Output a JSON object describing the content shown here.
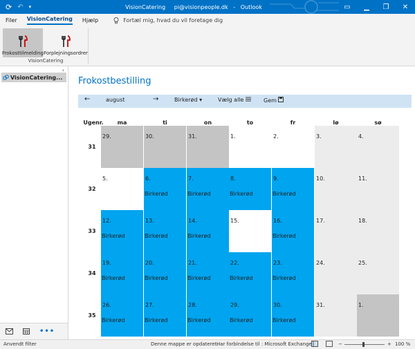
{
  "titlebar": {
    "app_name": "VisionCatering",
    "account": "pi@visionpeople.dk",
    "separator": "-",
    "product": "Outlook",
    "sync_icon": "refresh-icon",
    "undo_icon": "undo-icon",
    "controls": [
      "▭",
      "▁",
      "❐",
      "✕"
    ]
  },
  "menu": {
    "items": [
      "Filer",
      "VisionCatering",
      "Hjælp"
    ],
    "active": "VisionCatering",
    "tell_me": "Fortæl mig, hvad du vil foretage dig"
  },
  "ribbon": {
    "buttons": [
      {
        "label": "Frokosttilmelding",
        "icon": "cutlery-icon",
        "selected": true
      },
      {
        "label": "Forplejningsordrer",
        "icon": "cutlery-icon",
        "selected": false
      }
    ],
    "group_label": "VisionCatering"
  },
  "leftnav": {
    "collapse": "‹",
    "folder": "VisionCatering...",
    "folder_icon": "link-icon",
    "bottom_icons": [
      "mail-icon",
      "calendar-icon",
      "more-icon"
    ],
    "more_label": "•••"
  },
  "main": {
    "title": "Frokostbestilling",
    "toolbar": {
      "prev": "←",
      "month": "august",
      "next": "→",
      "location": "Birkerød",
      "dropdown": "▾",
      "select_all": "Vælg alle",
      "save": "Gem"
    }
  },
  "calendar": {
    "week_header": "Ugenr.",
    "days": [
      "ma",
      "ti",
      "on",
      "to",
      "fr",
      "lø",
      "sø"
    ],
    "weeks": [
      {
        "num": "31",
        "cells": [
          {
            "d": "29.",
            "s": "grey",
            "loc": ""
          },
          {
            "d": "30.",
            "s": "grey",
            "loc": ""
          },
          {
            "d": "31.",
            "s": "grey",
            "loc": ""
          },
          {
            "d": "1.",
            "s": "white",
            "loc": ""
          },
          {
            "d": "2.",
            "s": "white",
            "loc": ""
          },
          {
            "d": "3.",
            "s": "light",
            "loc": ""
          },
          {
            "d": "4.",
            "s": "light",
            "loc": ""
          }
        ]
      },
      {
        "num": "32",
        "cells": [
          {
            "d": "5.",
            "s": "white",
            "loc": ""
          },
          {
            "d": "6.",
            "s": "blue",
            "loc": "Birkerød"
          },
          {
            "d": "7.",
            "s": "blue",
            "loc": "Birkerød"
          },
          {
            "d": "8.",
            "s": "blue",
            "loc": "Birkerød"
          },
          {
            "d": "9.",
            "s": "blue",
            "loc": "Birkerød"
          },
          {
            "d": "10.",
            "s": "light",
            "loc": ""
          },
          {
            "d": "11.",
            "s": "light",
            "loc": ""
          }
        ]
      },
      {
        "num": "33",
        "cells": [
          {
            "d": "12.",
            "s": "blue",
            "loc": "Birkerød"
          },
          {
            "d": "13.",
            "s": "blue",
            "loc": "Birkerød"
          },
          {
            "d": "14.",
            "s": "blue",
            "loc": "Birkerød"
          },
          {
            "d": "15.",
            "s": "white",
            "loc": ""
          },
          {
            "d": "16.",
            "s": "blue",
            "loc": "Birkerød"
          },
          {
            "d": "17.",
            "s": "light",
            "loc": ""
          },
          {
            "d": "18.",
            "s": "light",
            "loc": ""
          }
        ]
      },
      {
        "num": "34",
        "cells": [
          {
            "d": "19.",
            "s": "blue",
            "loc": "Birkerød"
          },
          {
            "d": "20.",
            "s": "blue",
            "loc": "Birkerød"
          },
          {
            "d": "21.",
            "s": "blue",
            "loc": "Birkerød"
          },
          {
            "d": "22.",
            "s": "blue",
            "loc": "Birkerød"
          },
          {
            "d": "23.",
            "s": "blue",
            "loc": "Birkerød"
          },
          {
            "d": "24.",
            "s": "light",
            "loc": ""
          },
          {
            "d": "25.",
            "s": "light",
            "loc": ""
          }
        ]
      },
      {
        "num": "35",
        "cells": [
          {
            "d": "26.",
            "s": "blue",
            "loc": "Birkerød"
          },
          {
            "d": "27.",
            "s": "blue",
            "loc": "Birkerød"
          },
          {
            "d": "28.",
            "s": "blue",
            "loc": "Birkerød"
          },
          {
            "d": "29.",
            "s": "blue",
            "loc": "Birkerød"
          },
          {
            "d": "30.",
            "s": "blue",
            "loc": "Birkerød"
          },
          {
            "d": "31.",
            "s": "light",
            "loc": ""
          },
          {
            "d": "1.",
            "s": "grey",
            "loc": ""
          }
        ]
      }
    ]
  },
  "statusbar": {
    "filter": "Anvendt filter",
    "updated": "Denne mappe er opdateret.",
    "connection": "Har forbindelse til : Microsoft Exchange",
    "zoom_minus": "−",
    "zoom_plus": "+",
    "zoom": "100 %"
  },
  "colors": {
    "accent": "#0072c6",
    "booked": "#00a4ef",
    "toolbar_bg": "#cfe3f5",
    "past_day": "#c4c4c4",
    "weekend": "#ececec"
  }
}
